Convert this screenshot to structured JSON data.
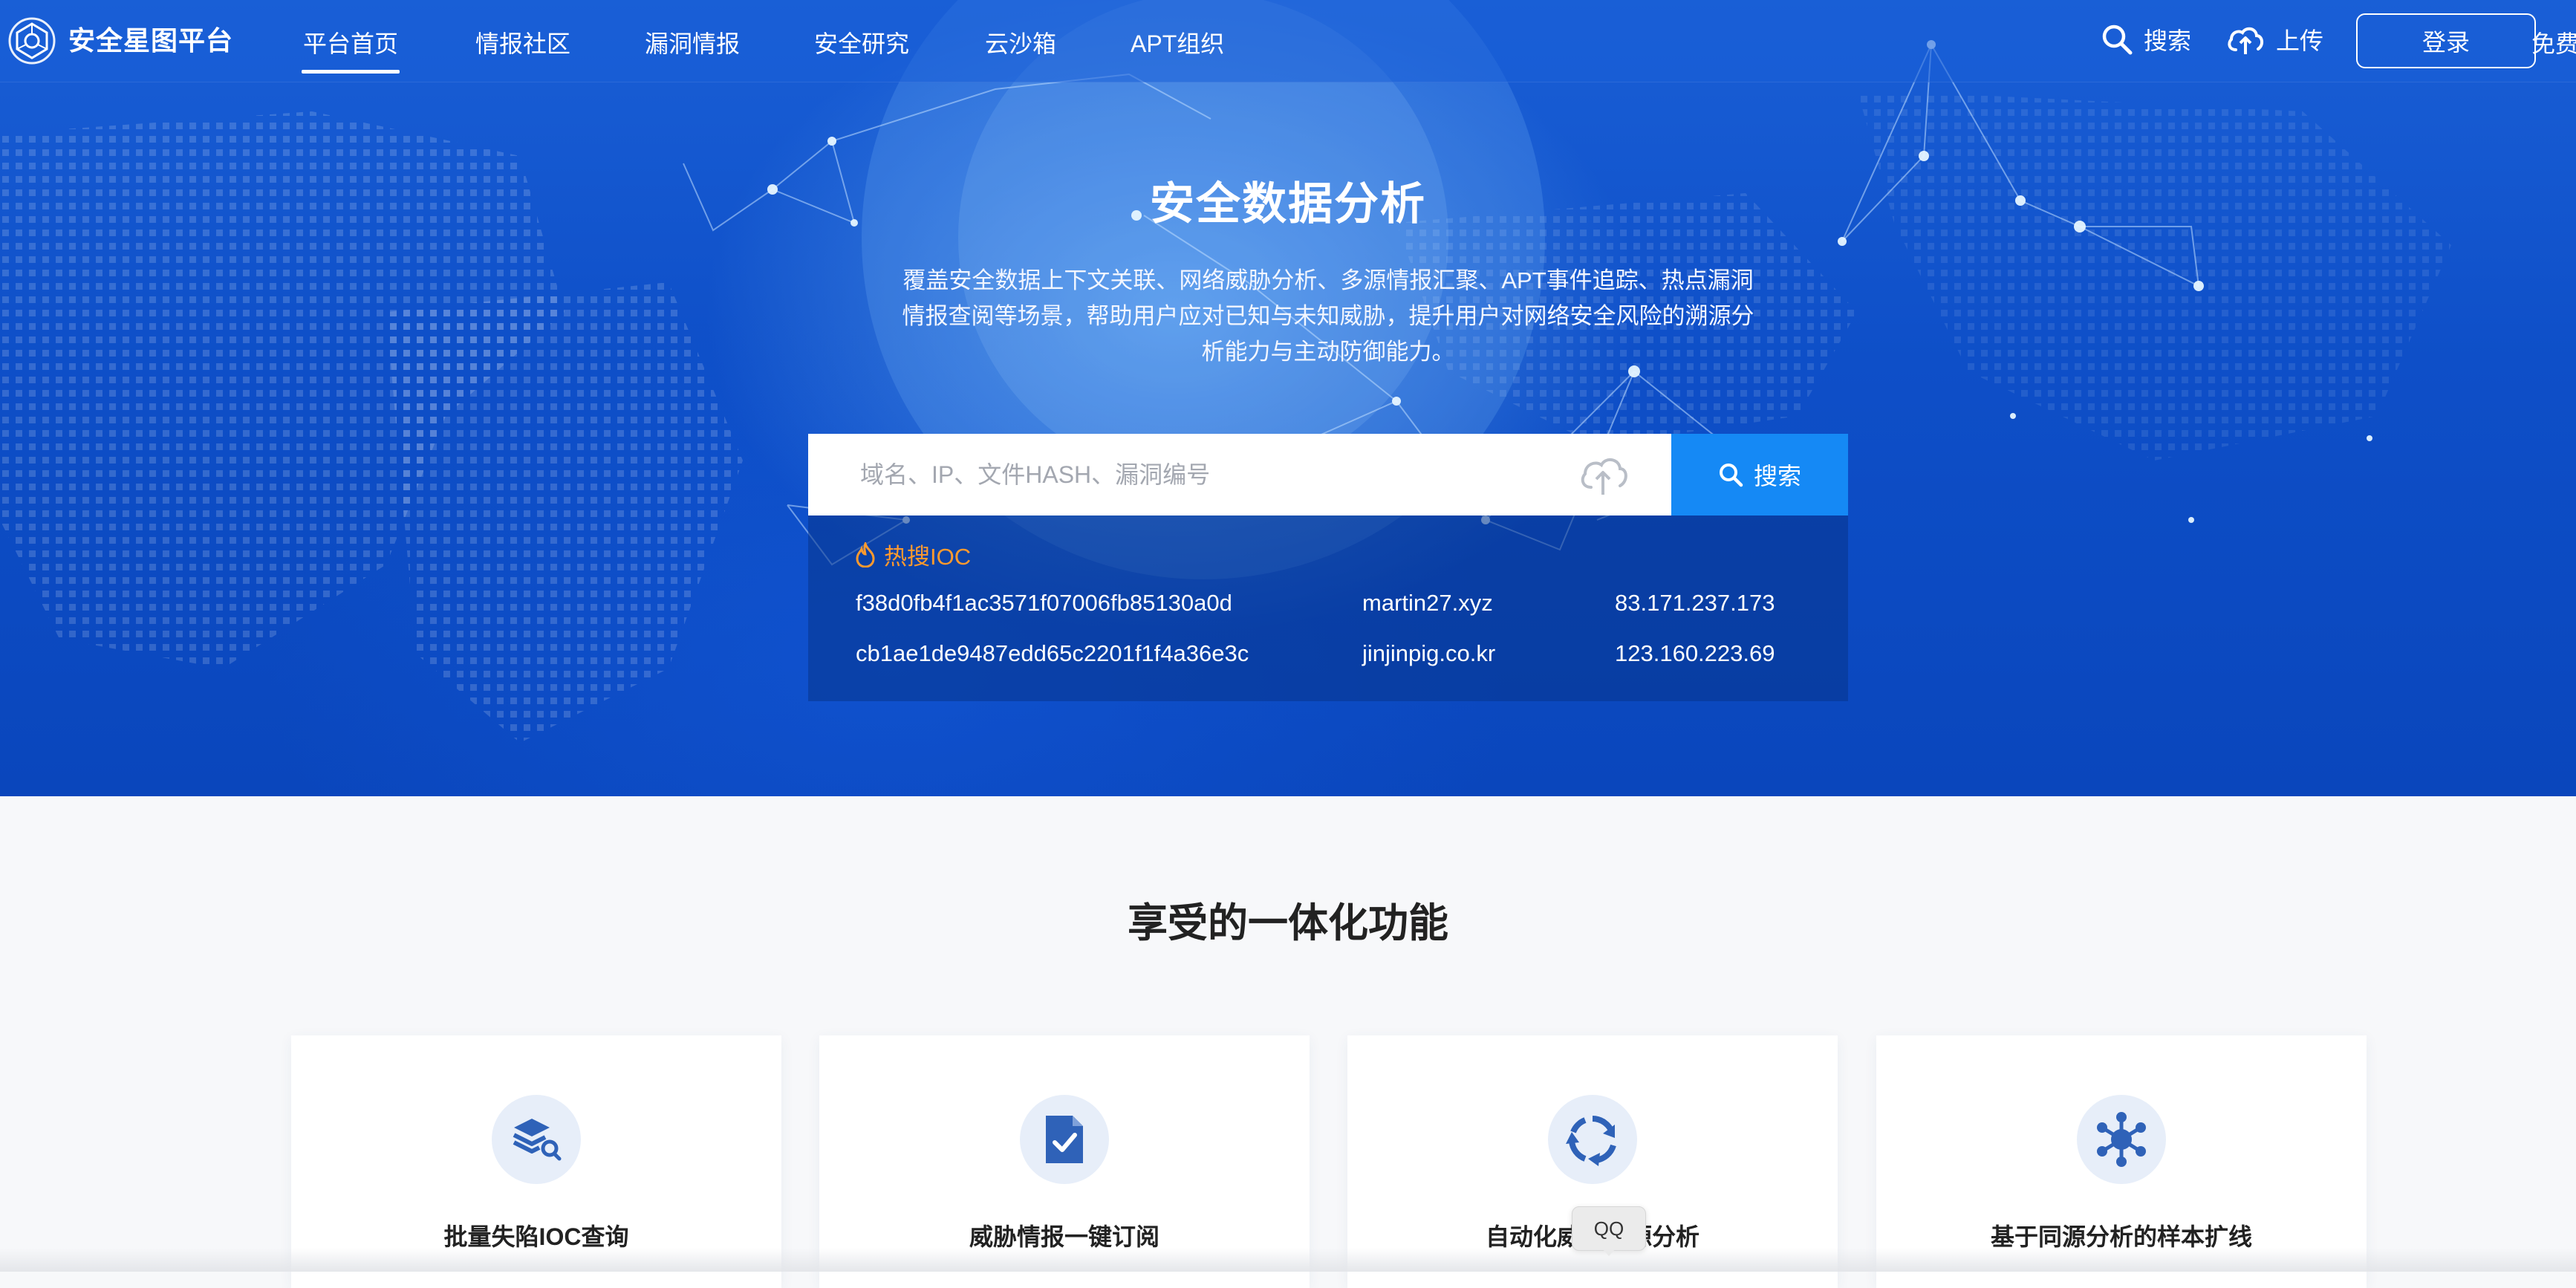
{
  "nav": {
    "brand": "安全星图平台",
    "items": [
      "平台首页",
      "情报社区",
      "漏洞情报",
      "安全研究",
      "云沙箱",
      "APT组织"
    ],
    "search_label": "搜索",
    "upload_label": "上传",
    "login_label": "登录",
    "free_label": "免费"
  },
  "hero": {
    "title": "安全数据分析",
    "desc_lines": [
      "覆盖安全数据上下文关联、网络威胁分析、多源情报汇聚、APT事件追踪、热点漏洞",
      "情报查阅等场景，帮助用户应对已知与未知威胁，提升用户对网络安全风险的溯源分",
      "析能力与主动防御能力。"
    ]
  },
  "search": {
    "placeholder": "域名、IP、文件HASH、漏洞编号",
    "button_label": "搜索"
  },
  "hot_ioc": {
    "title": "热搜IOC",
    "rows": [
      [
        "f38d0fb4f1ac3571f07006fb85130a0d",
        "martin27.xyz",
        "83.171.237.173"
      ],
      [
        "cb1ae1de9487edd65c2201f1f4a36e3c",
        "jinjinpig.co.kr",
        "123.160.223.69"
      ]
    ]
  },
  "features": {
    "title": "享受的一体化功能",
    "cards": [
      {
        "title": "批量失陷IOC查询",
        "icon": "layers-search-icon"
      },
      {
        "title": "威胁情报一键订阅",
        "icon": "document-check-icon"
      },
      {
        "title": "自动化威胁溯源分析",
        "icon": "refresh-cycle-icon"
      },
      {
        "title": "基于同源分析的样本扩线",
        "icon": "network-hub-icon"
      }
    ]
  },
  "tooltip": {
    "label": "QQ"
  },
  "colors": {
    "primary": "#1589f5",
    "hero_bg": "#0e4fc8",
    "hot_accent": "#ff9a2e",
    "icon_blue": "#2f62b8"
  }
}
